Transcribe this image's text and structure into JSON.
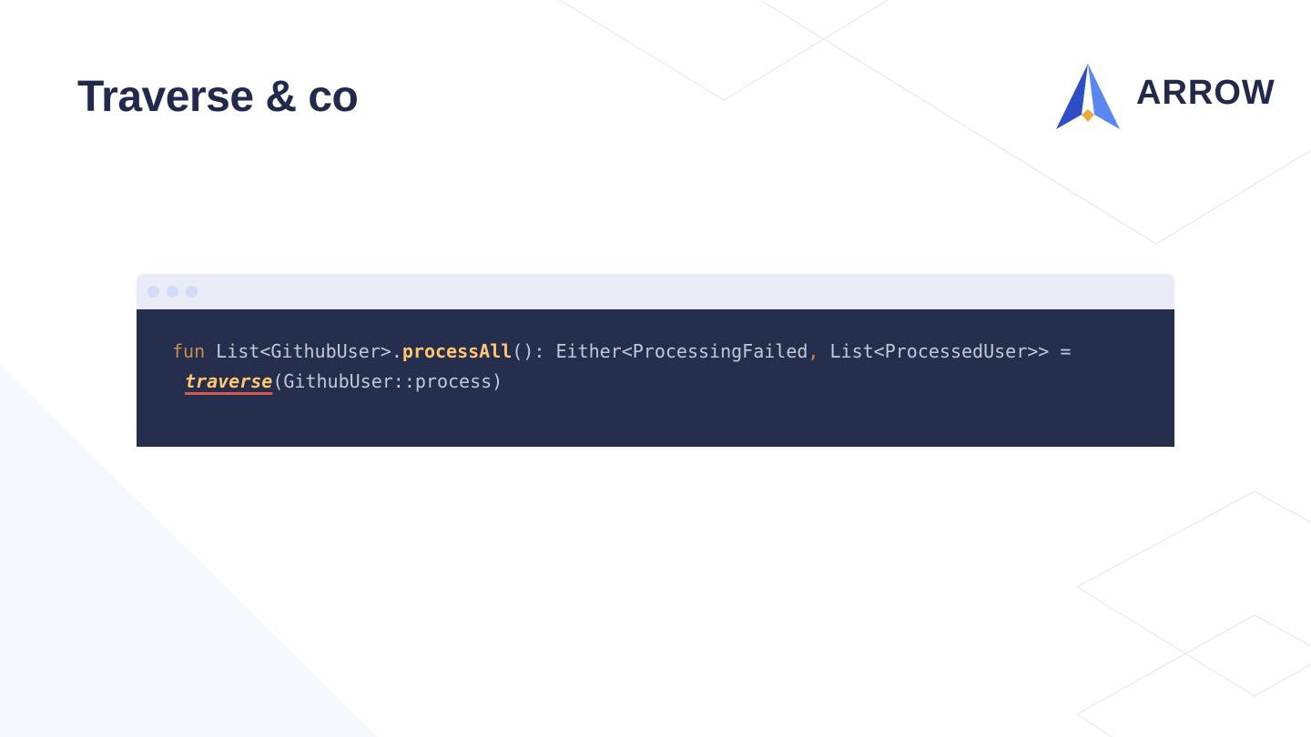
{
  "slide": {
    "title": "Traverse & co"
  },
  "logo": {
    "wordmark": "ARROW",
    "icon": "arrow-logo-icon",
    "colors": {
      "left_face": "#2d4ec4",
      "right_face": "#5b87f0",
      "tip": "#f0a93f",
      "wordmark": "#22294a"
    }
  },
  "code_window": {
    "window_controls": [
      "dot",
      "dot",
      "dot"
    ],
    "lines": [
      [
        {
          "text": "fun",
          "kind": "keyword"
        },
        {
          "text": " List<GithubUser>.",
          "kind": "plain"
        },
        {
          "text": "processAll",
          "kind": "fn-def"
        },
        {
          "text": "(): Either<ProcessingFailed",
          "kind": "plain"
        },
        {
          "text": ",",
          "kind": "keyword"
        },
        {
          "text": " List<ProcessedUser>> =",
          "kind": "plain"
        }
      ],
      [
        {
          "text": "traverse",
          "kind": "fn-call"
        },
        {
          "text": "(GithubUser::process)",
          "kind": "plain"
        }
      ]
    ]
  },
  "colors": {
    "title": "#212a4d",
    "background": "#ffffff",
    "background_shape": "#f6f8fd",
    "background_lines": "#e3e5ea",
    "titlebar": "#e9ebf7",
    "titlebar_dots": "#d3dcf6",
    "code_background": "#262e4e",
    "code_plain": "#c2c8d6",
    "code_keyword": "#cc8a4e",
    "code_function": "#ffc66d",
    "code_underline": "#d75a4f"
  }
}
